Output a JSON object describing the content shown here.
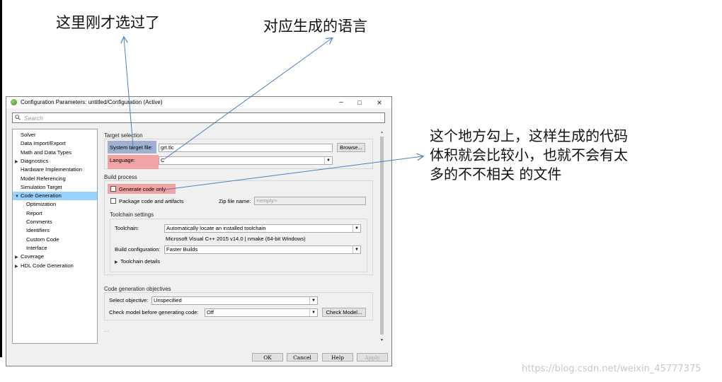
{
  "annotations": {
    "top_left": "这里刚才选过了",
    "top_right": "对应生成的语言",
    "right_lines": [
      "这个地方勾上，这样生成的代码",
      "体积就会比较小，也就不会有太",
      "多的不不相关 的文件"
    ]
  },
  "watermark": "https://blog.csdn.net/weixin_45777375",
  "dialog": {
    "title": "Configuration Parameters: untitled/Configuration (Active)",
    "window_buttons": [
      "–",
      "□",
      "×"
    ],
    "search_placeholder": "Search",
    "tree": [
      {
        "label": "Solver",
        "level": 0,
        "expander": ""
      },
      {
        "label": "Data Import/Export",
        "level": 0,
        "expander": ""
      },
      {
        "label": "Math and Data Types",
        "level": 0,
        "expander": ""
      },
      {
        "label": "Diagnostics",
        "level": 0,
        "expander": "▶"
      },
      {
        "label": "Hardware Implementation",
        "level": 0,
        "expander": ""
      },
      {
        "label": "Model Referencing",
        "level": 0,
        "expander": ""
      },
      {
        "label": "Simulation Target",
        "level": 0,
        "expander": ""
      },
      {
        "label": "Code Generation",
        "level": 0,
        "expander": "▼",
        "selected": true
      },
      {
        "label": "Optimization",
        "level": 1,
        "expander": ""
      },
      {
        "label": "Report",
        "level": 1,
        "expander": ""
      },
      {
        "label": "Comments",
        "level": 1,
        "expander": ""
      },
      {
        "label": "Identifiers",
        "level": 1,
        "expander": ""
      },
      {
        "label": "Custom Code",
        "level": 1,
        "expander": ""
      },
      {
        "label": "Interface",
        "level": 1,
        "expander": ""
      },
      {
        "label": "Coverage",
        "level": 0,
        "expander": "▶"
      },
      {
        "label": "HDL Code Generation",
        "level": 0,
        "expander": "▶"
      }
    ],
    "target_selection": {
      "title": "Target selection",
      "system_target_label": "System target file:",
      "system_target_value": "grt.tlc",
      "browse_label": "Browse...",
      "language_label": "Language:",
      "language_value": "C"
    },
    "build_process": {
      "title": "Build process",
      "generate_code_only_label": "Generate code only",
      "generate_code_only_checked": false,
      "package_label": "Package code and artifacts",
      "package_checked": false,
      "zip_label": "Zip file name:",
      "zip_placeholder": "<empty>",
      "toolchain_settings_title": "Toolchain settings",
      "toolchain_label": "Toolchain:",
      "toolchain_value": "Automatically locate an installed toolchain",
      "toolchain_info": "Microsoft Visual C++ 2015 v14.0 | nmake (64-bit Windows)",
      "build_config_label": "Build configuration:",
      "build_config_value": "Faster Builds",
      "toolchain_details_label": "Toolchain details"
    },
    "objectives": {
      "title": "Code generation objectives",
      "select_objective_label": "Select objective:",
      "select_objective_value": "Unspecified",
      "check_model_label": "Check model before generating code:",
      "check_model_value": "Off",
      "check_model_button": "Check Model..."
    },
    "ellipsis": "...",
    "footer_buttons": {
      "ok": "OK",
      "cancel": "Cancel",
      "help": "Help",
      "apply": "Apply"
    }
  },
  "colors": {
    "selection": "#99d1ff",
    "highlight_blue": "#9fb0d0",
    "highlight_red": "#f29696",
    "arrow": "#4a7fc0"
  },
  "icons": [
    "matlab-icon",
    "search-icon",
    "minimize-icon",
    "maximize-icon",
    "close-icon",
    "dropdown-arrow-icon",
    "expand-triangle-icon"
  ]
}
